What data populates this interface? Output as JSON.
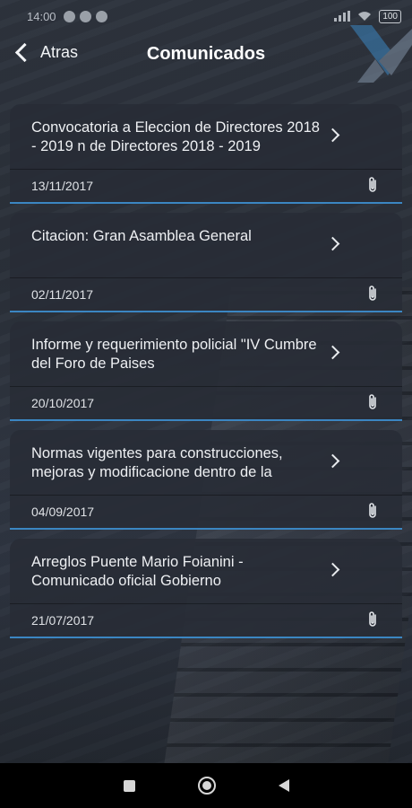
{
  "status_bar": {
    "time": "14:00",
    "battery": "100"
  },
  "header": {
    "back_label": "Atras",
    "title": "Comunicados"
  },
  "items": [
    {
      "title": "Convocatoria a Eleccion de Directores 2018 - 2019 n de Directores 2018 - 2019",
      "date": "13/11/2017"
    },
    {
      "title": "Citacion: Gran Asamblea General",
      "date": "02/11/2017"
    },
    {
      "title": "Informe y requerimiento policial \"IV Cumbre del Foro de Paises",
      "date": "20/10/2017"
    },
    {
      "title": "Normas vigentes para construcciones, mejoras y modificacione dentro de la",
      "date": "04/09/2017"
    },
    {
      "title": "Arreglos Puente Mario Foianini - Comunicado oficial Gobierno",
      "date": "21/07/2017"
    }
  ],
  "icons": {
    "back": "chevron-left-icon",
    "item_arrow": "chevron-right-icon",
    "attachment": "paperclip-icon",
    "nav_recents": "square-icon",
    "nav_home": "circle-icon",
    "nav_back": "triangle-back-icon"
  },
  "colors": {
    "accent": "#3b86c2",
    "background": "#2b313b",
    "card": "#282d36"
  }
}
